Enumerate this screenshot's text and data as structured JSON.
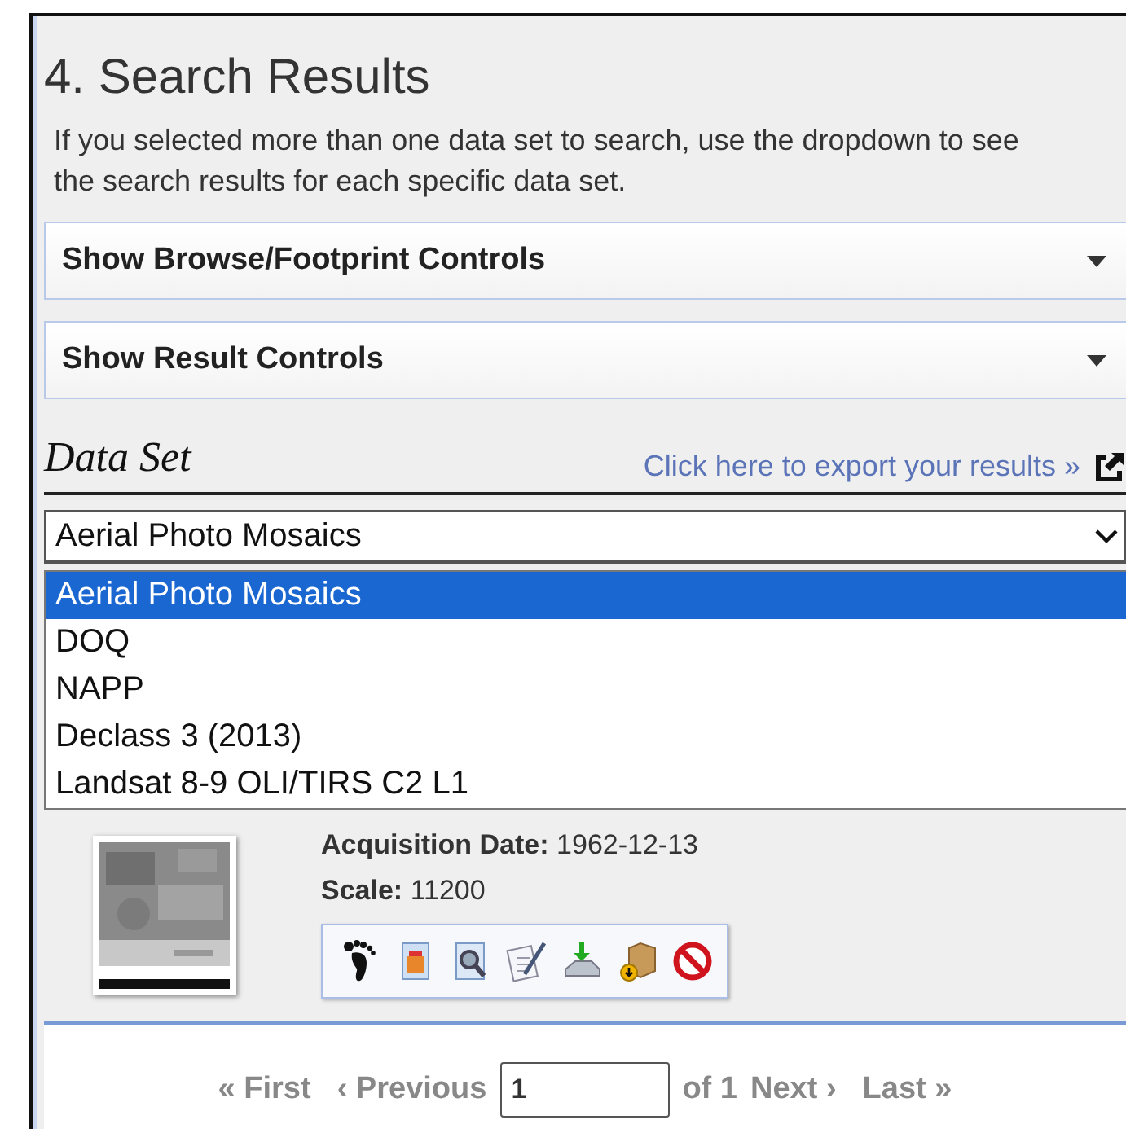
{
  "title": "4. Search Results",
  "intro": "If you selected more than one data set to search, use the dropdown to see the search results for each specific data set.",
  "panels": [
    {
      "label": "Show Browse/Footprint Controls",
      "expanded": false
    },
    {
      "label": "Show Result Controls",
      "expanded": false
    }
  ],
  "dataset_heading": "Data Set",
  "export_link": "Click here to export your results »",
  "dataset_select": {
    "value": "Aerial Photo Mosaics",
    "open": true,
    "options": [
      {
        "label": "Aerial Photo Mosaics",
        "selected": true
      },
      {
        "label": "DOQ",
        "selected": false
      },
      {
        "label": "NAPP",
        "selected": false
      },
      {
        "label": "Declass 3 (2013)",
        "selected": false
      },
      {
        "label": "Landsat 8-9 OLI/TIRS C2 L1",
        "selected": false
      }
    ]
  },
  "result": {
    "fields": [
      {
        "label": "Acquisition Date:",
        "value": "1962-12-13"
      },
      {
        "label": "Scale:",
        "value": "11200"
      }
    ],
    "actions": [
      {
        "kind": "footprint"
      },
      {
        "kind": "browse"
      },
      {
        "kind": "preview"
      },
      {
        "kind": "metadata"
      },
      {
        "kind": "download"
      },
      {
        "kind": "bulk"
      },
      {
        "kind": "exclude"
      }
    ]
  },
  "pagination": {
    "first": "« First",
    "previous": "‹ Previous",
    "page": "1",
    "of": "of 1",
    "next": "Next ›",
    "last": "Last »"
  }
}
